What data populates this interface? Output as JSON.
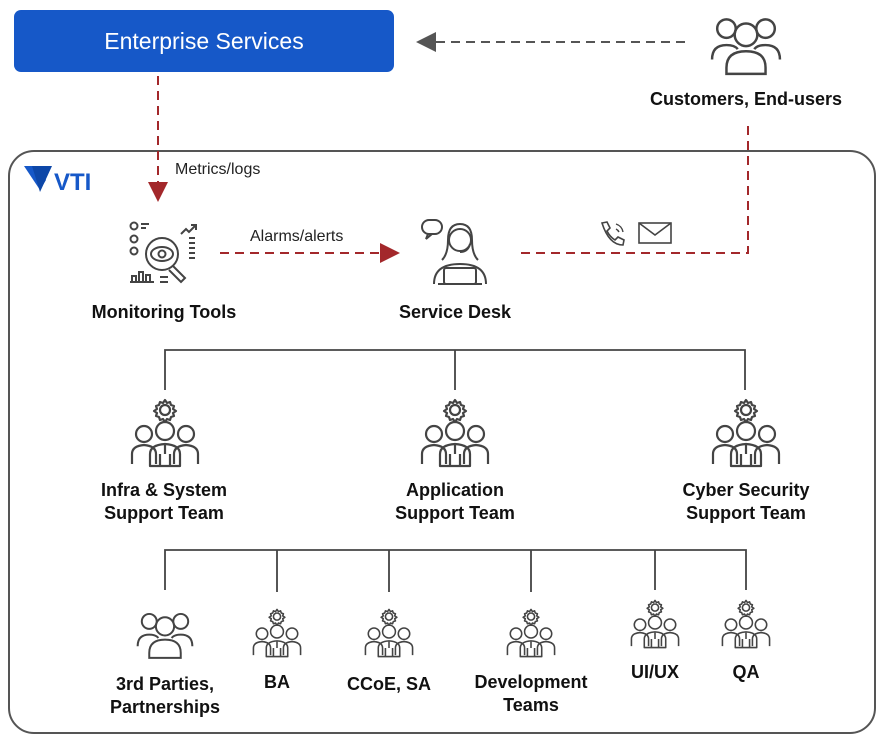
{
  "enterprise": {
    "label": "Enterprise Services",
    "color": "#1658c8"
  },
  "customers": {
    "label": "Customers, End-users",
    "icon": "users-group-icon"
  },
  "logo": {
    "text": "VTI",
    "color": "#1658c8"
  },
  "edges": {
    "metrics": "Metrics/logs",
    "alarms": "Alarms/alerts",
    "arrow_color": "#a3282b"
  },
  "monitoring": {
    "label": "Monitoring Tools",
    "icon": "monitoring-eye-icon"
  },
  "service_desk": {
    "label": "Service Desk",
    "icon": "service-desk-agent-icon"
  },
  "contact_icons": [
    "phone-icon",
    "mail-icon"
  ],
  "support_teams": [
    {
      "line1": "Infra & System",
      "line2": "Support Team"
    },
    {
      "line1": "Application",
      "line2": "Support Team"
    },
    {
      "line1": "Cyber Security",
      "line2": "Support Team"
    }
  ],
  "sub_teams": [
    {
      "line1": "3rd Parties,",
      "line2": "Partnerships"
    },
    {
      "line1": "BA",
      "line2": ""
    },
    {
      "line1": "CCoE, SA",
      "line2": ""
    },
    {
      "line1": "Development",
      "line2": "Teams"
    },
    {
      "line1": "UI/UX",
      "line2": ""
    },
    {
      "line1": "QA",
      "line2": ""
    }
  ]
}
